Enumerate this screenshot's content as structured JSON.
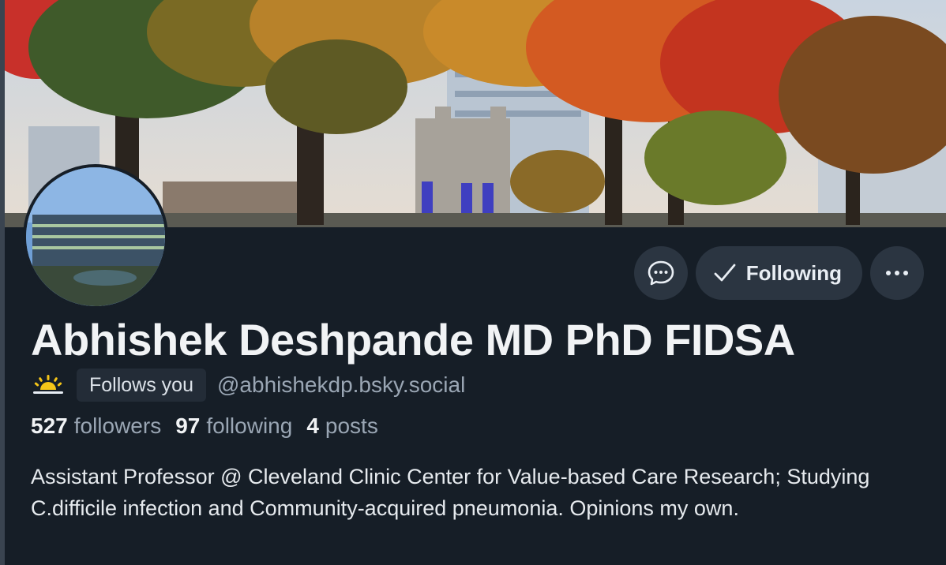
{
  "profile": {
    "display_name": "Abhishek Deshpande MD PhD FIDSA",
    "handle": "@abhishekdp.bsky.social",
    "follows_you_label": "Follows you",
    "bio": "Assistant Professor @ Cleveland Clinic Center for Value-based Care Research; Studying C.difficile infection and Community-acquired pneumonia. Opinions my own."
  },
  "stats": {
    "followers_count": "527",
    "followers_label": "followers",
    "following_count": "97",
    "following_label": "following",
    "posts_count": "4",
    "posts_label": "posts"
  },
  "actions": {
    "message_icon": "chat-bubble-icon",
    "following_label": "Following",
    "following_icon": "check-icon",
    "more_icon": "ellipsis-icon"
  },
  "icons": {
    "status_icon": "sunrise-icon"
  },
  "colors": {
    "background": "#161e27",
    "button_bg": "#2b3541",
    "text_primary": "#f1f3f5",
    "text_secondary": "#9aa6b4",
    "sunrise_yellow": "#f5c518"
  }
}
